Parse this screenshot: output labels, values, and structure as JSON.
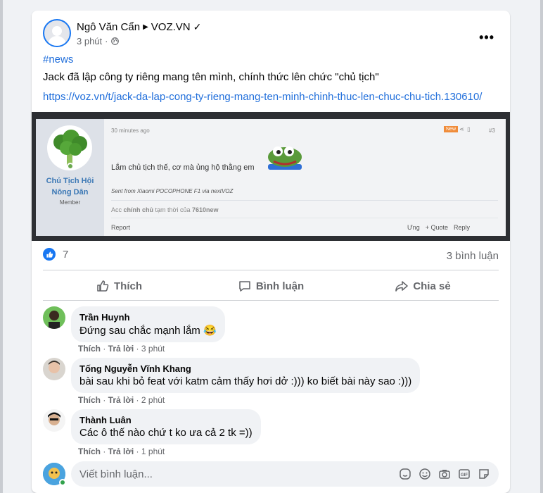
{
  "post": {
    "author": "Ngô Văn Cẩn",
    "page": "VOZ.VN",
    "verified_glyph": "✓",
    "time": "3 phút",
    "hashtag": "#news",
    "text": "Jack đã lập công ty riêng mang tên mình, chính thức lên chức \"chủ tịch\"",
    "link": "https://voz.vn/t/jack-da-lap-cong-ty-rieng-mang-ten-minh-chinh-thuc-len-chuc-chu-tich.130610/"
  },
  "embedded": {
    "user_name_line1": "Chủ Tịch Hội",
    "user_name_line2": "Nông Dân",
    "user_role": "Member",
    "time": "30 minutes ago",
    "new_badge": "New",
    "post_number": "#3",
    "message": "Lắm chủ tịch thế, cơ mà ủng hộ thằng em",
    "sent_from": "Sent from Xiaomi POCOPHONE F1 via nextVOZ",
    "account_note_prefix": "Acc",
    "account_note_bold1": "chính chủ",
    "account_note_mid": "tạm thời của",
    "account_note_bold2": "7610new",
    "report": "Report",
    "action_like": "Ưng",
    "action_quote": "+ Quote",
    "action_reply": "Reply"
  },
  "stats": {
    "reactions": "7",
    "comments": "3 bình luận"
  },
  "actions": {
    "like": "Thích",
    "comment": "Bình luận",
    "share": "Chia sẻ"
  },
  "comments": [
    {
      "name": "Trần Huynh",
      "text": "Đứng sau chắc mạnh lắm 😂",
      "like": "Thích",
      "reply": "Trả lời",
      "time": "3 phút"
    },
    {
      "name": "Tống Nguyễn Vĩnh Khang",
      "text": "bài sau khi bỏ feat với katm cảm thấy hơi dở :))) ko biết bài này sao :)))",
      "like": "Thích",
      "reply": "Trả lời",
      "time": "2 phút"
    },
    {
      "name": "Thành Luân",
      "text": "Các ô thế nào chứ t ko ưa cả 2 tk =))",
      "like": "Thích",
      "reply": "Trả lời",
      "time": "1 phút"
    }
  ],
  "write_comment": {
    "placeholder": "Viết bình luận..."
  },
  "colors": {
    "accent": "#1877f2",
    "link": "#216fdb",
    "muted": "#65676b"
  }
}
